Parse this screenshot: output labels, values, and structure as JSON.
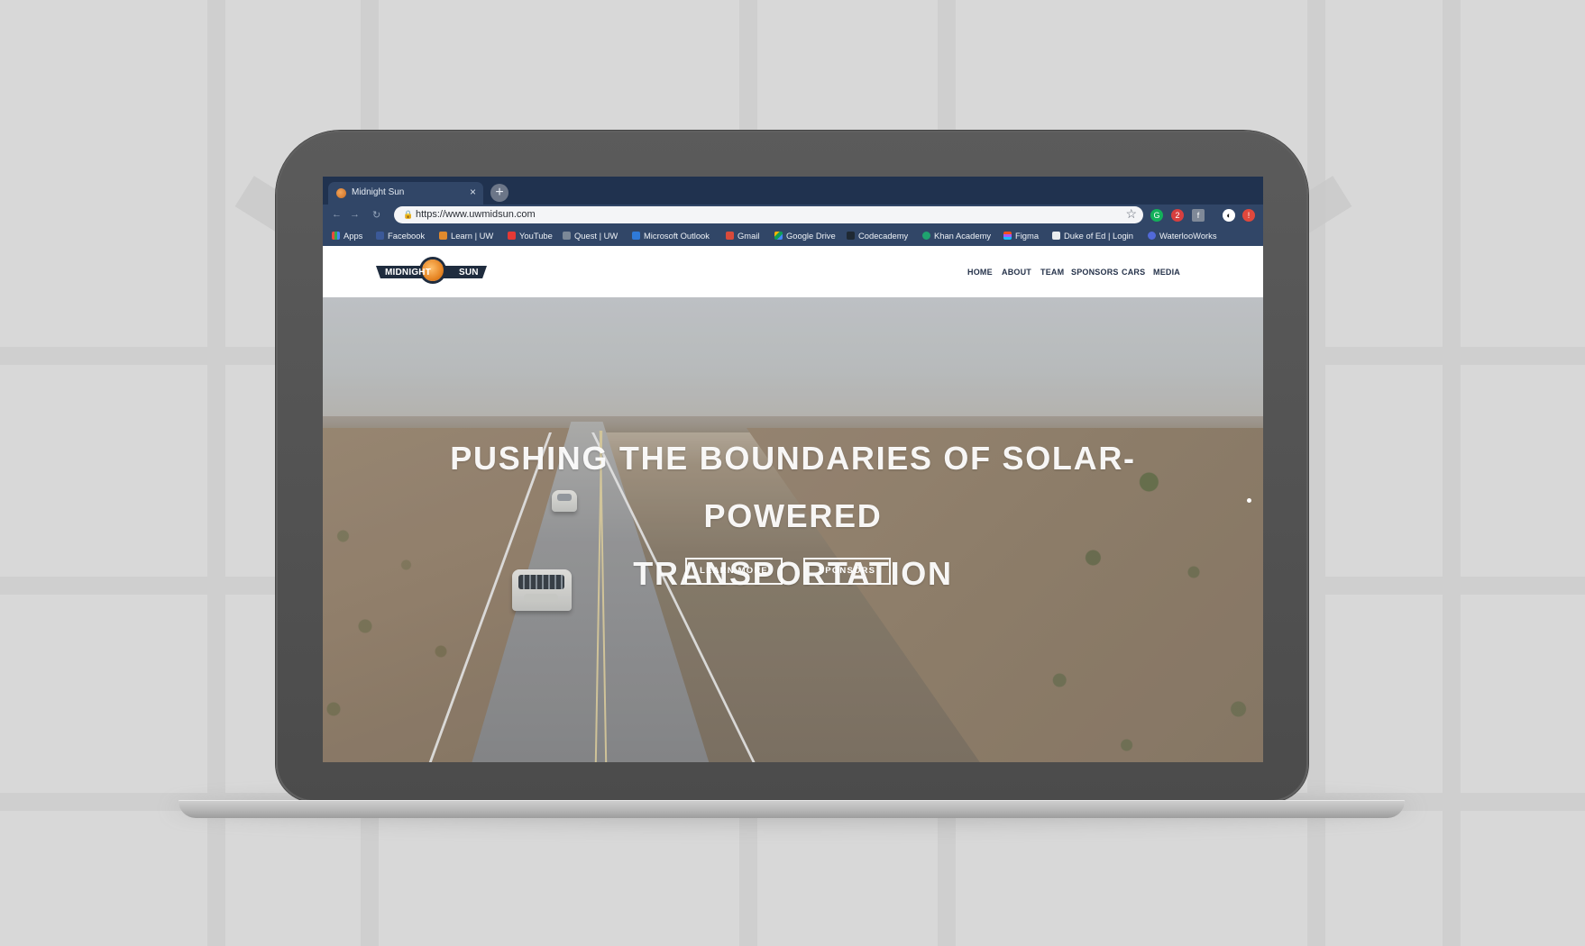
{
  "browser": {
    "tab_title": "Midnight Sun",
    "tab_close": "×",
    "new_tab": "+",
    "url": "https://www.uwmidsun.com",
    "bookmarks": [
      "Apps",
      "Facebook",
      "Learn | UW",
      "YouTube",
      "Quest | UW",
      "Microsoft Outlook",
      "Gmail",
      "Google Drive",
      "Codecademy",
      "Khan Academy",
      "Figma",
      "Duke of Ed | Login",
      "WaterlooWorks"
    ]
  },
  "site": {
    "logo_left": "MIDNIGHT",
    "logo_right": "SUN",
    "nav": [
      "HOME",
      "ABOUT",
      "TEAM",
      "SPONSORS",
      "CARS",
      "MEDIA"
    ],
    "hero_line_1": "PUSHING THE BOUNDARIES OF SOLAR-POWERED",
    "hero_line_2": "TRANSPORTATION",
    "buttons": {
      "learn_more": "LEARN MORE",
      "sponsors": "SPONSORS"
    }
  },
  "colors": {
    "tab_bar": "#20324f",
    "toolbar": "#314667",
    "logo_navy": "#1f2c3e",
    "sun_orange": "#e68422",
    "nav_text": "#25324a"
  },
  "icons": {
    "back": "←",
    "forward": "→",
    "reload": "↻",
    "lock": "🔒",
    "star": "☆",
    "grammarly": "G",
    "adblock": "2",
    "facebook_ext": "f",
    "profile": "◐",
    "alert": "!"
  }
}
